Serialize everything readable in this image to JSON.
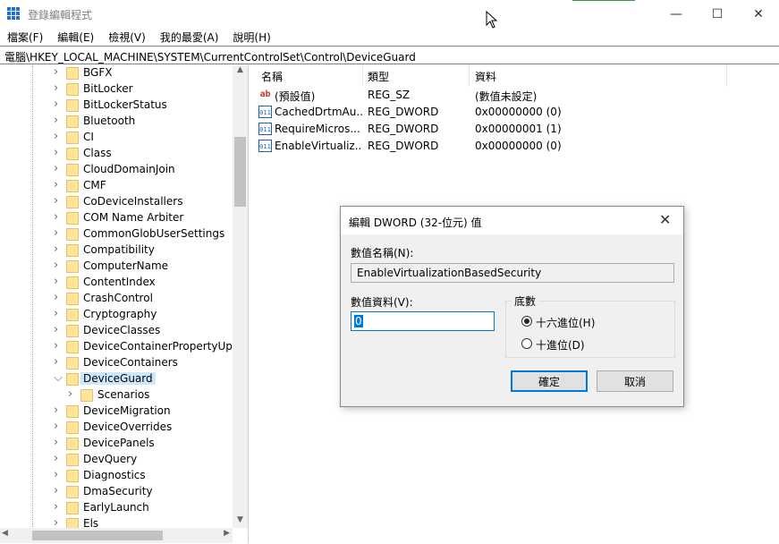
{
  "window": {
    "title": "登錄編輯程式",
    "minimize_glyph": "—",
    "maximize_glyph": "☐",
    "close_glyph": "✕"
  },
  "menu": [
    "檔案(F)",
    "編輯(E)",
    "檢視(V)",
    "我的最愛(A)",
    "說明(H)"
  ],
  "address": "電腦\\HKEY_LOCAL_MACHINE\\SYSTEM\\CurrentControlSet\\Control\\DeviceGuard",
  "tree": {
    "items": [
      {
        "label": "BGFX",
        "expanded": false,
        "level": 1
      },
      {
        "label": "BitLocker",
        "expanded": false,
        "level": 1
      },
      {
        "label": "BitLockerStatus",
        "expanded": false,
        "level": 1
      },
      {
        "label": "Bluetooth",
        "expanded": false,
        "level": 1
      },
      {
        "label": "CI",
        "expanded": false,
        "level": 1
      },
      {
        "label": "Class",
        "expanded": false,
        "level": 1
      },
      {
        "label": "CloudDomainJoin",
        "expanded": false,
        "level": 1
      },
      {
        "label": "CMF",
        "expanded": false,
        "level": 1
      },
      {
        "label": "CoDeviceInstallers",
        "expanded": false,
        "level": 1
      },
      {
        "label": "COM Name Arbiter",
        "expanded": false,
        "level": 1
      },
      {
        "label": "CommonGlobUserSettings",
        "expanded": false,
        "level": 1
      },
      {
        "label": "Compatibility",
        "expanded": false,
        "level": 1
      },
      {
        "label": "ComputerName",
        "expanded": false,
        "level": 1
      },
      {
        "label": "ContentIndex",
        "expanded": false,
        "level": 1
      },
      {
        "label": "CrashControl",
        "expanded": false,
        "level": 1
      },
      {
        "label": "Cryptography",
        "expanded": false,
        "level": 1
      },
      {
        "label": "DeviceClasses",
        "expanded": false,
        "level": 1
      },
      {
        "label": "DeviceContainerPropertyUpd",
        "expanded": false,
        "level": 1
      },
      {
        "label": "DeviceContainers",
        "expanded": false,
        "level": 1
      },
      {
        "label": "DeviceGuard",
        "expanded": true,
        "level": 1,
        "selected": true
      },
      {
        "label": "Scenarios",
        "expanded": false,
        "level": 2
      },
      {
        "label": "DeviceMigration",
        "expanded": false,
        "level": 1
      },
      {
        "label": "DeviceOverrides",
        "expanded": false,
        "level": 1
      },
      {
        "label": "DevicePanels",
        "expanded": false,
        "level": 1
      },
      {
        "label": "DevQuery",
        "expanded": false,
        "level": 1
      },
      {
        "label": "Diagnostics",
        "expanded": false,
        "level": 1
      },
      {
        "label": "DmaSecurity",
        "expanded": false,
        "level": 1
      },
      {
        "label": "EarlyLaunch",
        "expanded": false,
        "level": 1
      },
      {
        "label": "Els",
        "expanded": false,
        "level": 1
      }
    ]
  },
  "list": {
    "columns": [
      "名稱",
      "類型",
      "資料"
    ],
    "rows": [
      {
        "icon": "ab",
        "name": "(預設值)",
        "type": "REG_SZ",
        "data": "(數值未設定)"
      },
      {
        "icon": "011",
        "name": "CachedDrtmAu...",
        "type": "REG_DWORD",
        "data": "0x00000000 (0)"
      },
      {
        "icon": "011",
        "name": "RequireMicros...",
        "type": "REG_DWORD",
        "data": "0x00000001 (1)"
      },
      {
        "icon": "011",
        "name": "EnableVirtualiz...",
        "type": "REG_DWORD",
        "data": "0x00000000 (0)"
      }
    ]
  },
  "dialog": {
    "title": "編輯 DWORD (32-位元) 值",
    "close_glyph": "✕",
    "value_name_label": "數值名稱(N):",
    "value_name": "EnableVirtualizationBasedSecurity",
    "value_data_label": "數值資料(V):",
    "value_data": "0",
    "base_label": "底數",
    "radio_hex": "十六進位(H)",
    "radio_dec": "十進位(D)",
    "hex_selected": true,
    "ok": "確定",
    "cancel": "取消"
  },
  "colors": {
    "selection": "#cce8ff",
    "accent": "#0078d7",
    "folder": "#ffe49c"
  }
}
